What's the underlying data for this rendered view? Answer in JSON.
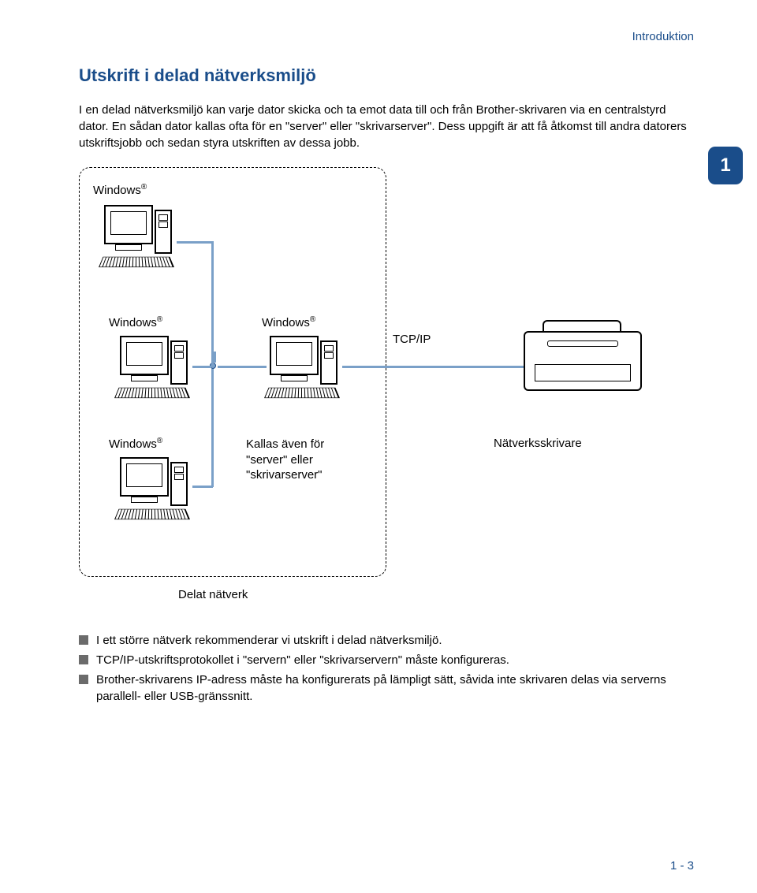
{
  "header": "Introduktion",
  "section_title": "Utskrift i delad nätverksmiljö",
  "intro": "I en delad nätverksmiljö kan varje dator skicka och ta emot data till och från Brother-skrivaren via en centralstyrd dator. En sådan dator kallas ofta för en \"server\" eller \"skrivarserver\". Dess uppgift är att få åtkomst till andra datorers utskriftsjobb och sedan styra utskriften av dessa jobb.",
  "chapter": "1",
  "labels": {
    "windows": "Windows",
    "reg": "®",
    "tcpip": "TCP/IP",
    "server_note_l1": "Kallas även för",
    "server_note_l2": "\"server\" eller",
    "server_note_l3": "\"skrivarserver\"",
    "printer": "Nätverksskrivare",
    "shared": "Delat nätverk"
  },
  "bullets": [
    "I ett större nätverk rekommenderar vi utskrift i delad nätverksmiljö.",
    "TCP/IP-utskriftsprotokollet i \"servern\" eller \"skrivarservern\" måste konfigureras.",
    "Brother-skrivarens IP-adress måste ha konfigurerats på lämpligt sätt, såvida inte skrivaren delas via serverns parallell- eller USB-gränssnitt."
  ],
  "footer": "1 - 3"
}
